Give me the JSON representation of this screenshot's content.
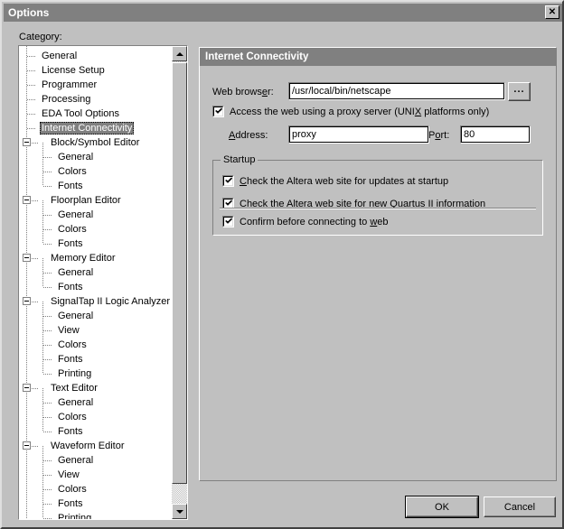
{
  "window": {
    "title": "Options",
    "close_icon": "close-icon",
    "close_glyph": "✕"
  },
  "category": {
    "label": "Category:",
    "selected": "Internet Connectivity",
    "items": [
      {
        "label": "General",
        "depth": 1,
        "expander": false
      },
      {
        "label": "License Setup",
        "depth": 1,
        "expander": false
      },
      {
        "label": "Programmer",
        "depth": 1,
        "expander": false
      },
      {
        "label": "Processing",
        "depth": 1,
        "expander": false
      },
      {
        "label": "EDA Tool Options",
        "depth": 1,
        "expander": false
      },
      {
        "label": "Internet Connectivity",
        "depth": 1,
        "expander": false,
        "selected": true
      },
      {
        "label": "Block/Symbol Editor",
        "depth": 0,
        "expander": true
      },
      {
        "label": "General",
        "depth": 2,
        "expander": false
      },
      {
        "label": "Colors",
        "depth": 2,
        "expander": false
      },
      {
        "label": "Fonts",
        "depth": 2,
        "expander": false
      },
      {
        "label": "Floorplan Editor",
        "depth": 0,
        "expander": true
      },
      {
        "label": "General",
        "depth": 2,
        "expander": false
      },
      {
        "label": "Colors",
        "depth": 2,
        "expander": false
      },
      {
        "label": "Fonts",
        "depth": 2,
        "expander": false
      },
      {
        "label": "Memory Editor",
        "depth": 0,
        "expander": true
      },
      {
        "label": "General",
        "depth": 2,
        "expander": false
      },
      {
        "label": "Fonts",
        "depth": 2,
        "expander": false
      },
      {
        "label": "SignalTap II Logic Analyzer",
        "depth": 0,
        "expander": true
      },
      {
        "label": "General",
        "depth": 2,
        "expander": false
      },
      {
        "label": "View",
        "depth": 2,
        "expander": false
      },
      {
        "label": "Colors",
        "depth": 2,
        "expander": false
      },
      {
        "label": "Fonts",
        "depth": 2,
        "expander": false
      },
      {
        "label": "Printing",
        "depth": 2,
        "expander": false
      },
      {
        "label": "Text Editor",
        "depth": 0,
        "expander": true
      },
      {
        "label": "General",
        "depth": 2,
        "expander": false
      },
      {
        "label": "Colors",
        "depth": 2,
        "expander": false
      },
      {
        "label": "Fonts",
        "depth": 2,
        "expander": false
      },
      {
        "label": "Waveform Editor",
        "depth": 0,
        "expander": true
      },
      {
        "label": "General",
        "depth": 2,
        "expander": false
      },
      {
        "label": "View",
        "depth": 2,
        "expander": false
      },
      {
        "label": "Colors",
        "depth": 2,
        "expander": false
      },
      {
        "label": "Fonts",
        "depth": 2,
        "expander": false
      },
      {
        "label": "Printing",
        "depth": 2,
        "expander": false
      }
    ]
  },
  "scrollbar": {
    "up_icon": "scroll-up-arrow-icon",
    "down_icon": "scroll-down-arrow-icon"
  },
  "panel": {
    "header": "Internet Connectivity",
    "web_browser_label": "Web browser:",
    "web_browser_value": "/usr/local/bin/netscape",
    "browse_label": "...",
    "proxy_checkbox_label_pre": "Access the web using a proxy server (UNI",
    "proxy_checkbox_accel": "X",
    "proxy_checkbox_label_post": " platforms only)",
    "proxy_checked": true,
    "address_label_pre": "",
    "address_label_accel": "A",
    "address_label_post": "ddress:",
    "address_value": "proxy",
    "port_label_pre": "P",
    "port_label_accel": "o",
    "port_label_post": "rt:",
    "port_value": "80",
    "startup": {
      "legend": "Startup",
      "items": [
        {
          "pre": "",
          "accel": "C",
          "post": "heck the Altera web site for updates at startup",
          "checked": true
        },
        {
          "pre": "Check the Altera web site for new Quartus II ",
          "accel": "i",
          "post": "nformation",
          "checked": true
        },
        {
          "pre": "Confirm before connecting to ",
          "accel": "w",
          "post": "eb",
          "checked": true
        }
      ]
    }
  },
  "footer": {
    "ok_label": "OK",
    "cancel_label": "Cancel"
  }
}
